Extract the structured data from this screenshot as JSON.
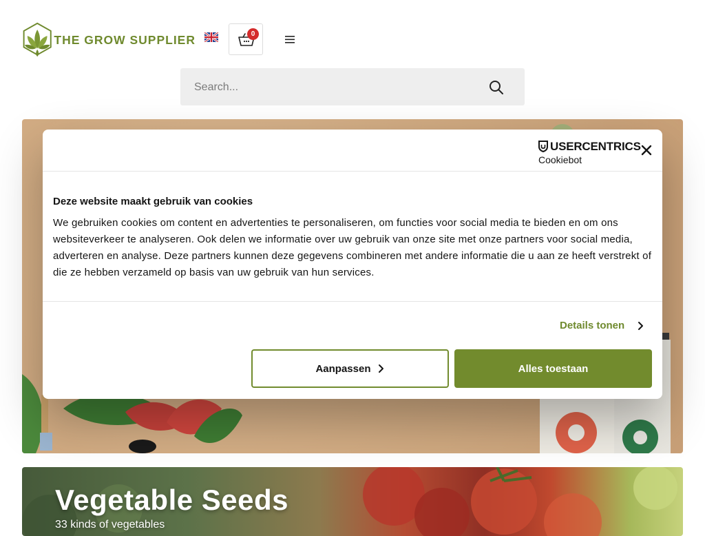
{
  "header": {
    "logo_text": "THE GROW SUPPLIER",
    "language_flag": "uk-flag-icon",
    "cart_count": "0",
    "cart_icon": "basket-icon",
    "menu_icon": "hamburger-menu-icon"
  },
  "search": {
    "placeholder": "Search...",
    "icon": "search-icon"
  },
  "cookie_dialog": {
    "brand_line1": "USERCENTRICS",
    "brand_line2": "Cookiebot",
    "title": "Deze website maakt gebruik van cookies",
    "body": "We gebruiken cookies om content en advertenties te personaliseren, om functies voor social media te bieden en om ons websiteverkeer te analyseren. Ook delen we informatie over uw gebruik van onze site met onze partners voor social media, adverteren en analyse. Deze partners kunnen deze gegevens combineren met andere informatie die u aan ze heeft verstrekt of die ze hebben verzameld op basis van uw gebruik van hun services.",
    "details_label": "Details tonen",
    "customize_label": "Aanpassen",
    "allow_all_label": "Alles toestaan"
  },
  "banner": {
    "title": "Vegetable Seeds",
    "subtitle": "33 kinds of vegetables"
  },
  "colors": {
    "brand_green": "#6f8a2e",
    "badge_red": "#d42b2b"
  }
}
